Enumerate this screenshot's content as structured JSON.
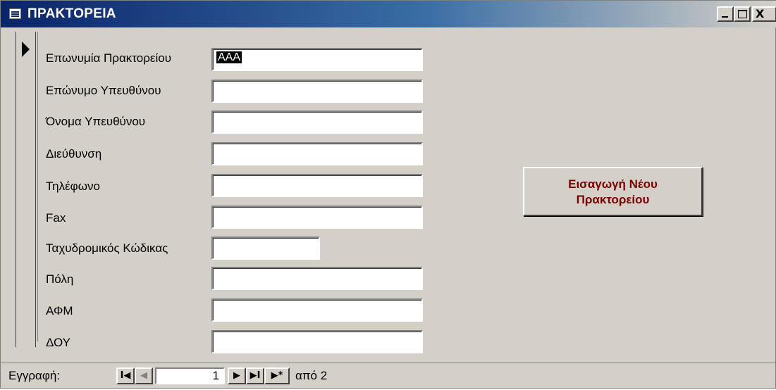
{
  "window": {
    "title": "ΠΡΑΚΤΟΡΕΙΑ",
    "icon": "form-icon",
    "controls": {
      "minimize": "",
      "maximize": "",
      "close": "X"
    }
  },
  "form": {
    "fields": [
      {
        "label": "Επωνυμία Πρακτορείου",
        "value": "ΑΑΑ",
        "selected": true
      },
      {
        "label": "Επώνυμο Υπευθύνου",
        "value": ""
      },
      {
        "label": "Όνομα Υπευθύνου",
        "value": ""
      },
      {
        "label": "Διεύθυνση",
        "value": ""
      },
      {
        "label": "Τηλέφωνο",
        "value": ""
      },
      {
        "label": "Fax",
        "value": ""
      },
      {
        "label": "Ταχυδρομικός Κώδικας",
        "value": ""
      },
      {
        "label": "Πόλη",
        "value": ""
      },
      {
        "label": "ΑΦΜ",
        "value": ""
      },
      {
        "label": "ΔΟΥ",
        "value": ""
      }
    ],
    "new_agency_button": {
      "line1": "Εισαγωγή Νέου",
      "line2": "Πρακτορείου"
    }
  },
  "navigation": {
    "label": "Εγγραφή:",
    "first": "I◀",
    "prev": "◀",
    "current_record": "1",
    "next": "▶",
    "last": "▶I",
    "new": "▶*",
    "of_text": "από 2"
  },
  "colors": {
    "title_gradient_start": "#0a246a",
    "title_gradient_end": "#d4d0c8",
    "button_text": "#7a0000",
    "face": "#d4d0c8"
  }
}
